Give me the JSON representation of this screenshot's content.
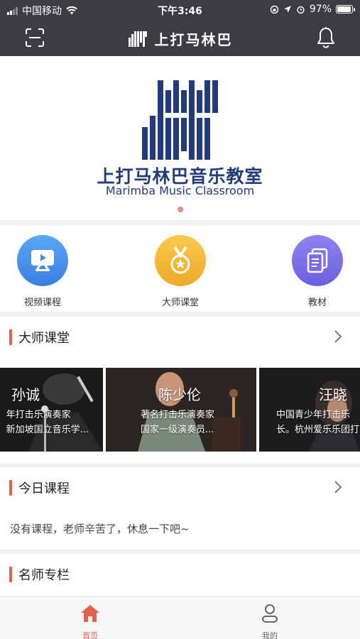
{
  "status_bar": {
    "carrier": "中国移动",
    "time": "下午3:46",
    "battery": "97%",
    "battery_level": 0.97
  },
  "header": {
    "title": "上打马林巴",
    "scan_icon": "scan-icon",
    "bell_icon": "bell-icon"
  },
  "banner": {
    "title_cn": "上打马林巴音乐教室",
    "title_en": "Marimba Music Classroom",
    "dot_color": "#e08a8a"
  },
  "categories": [
    {
      "label": "视频课程",
      "icon": "video-lesson-icon",
      "color": "#4a8ee8"
    },
    {
      "label": "大师课堂",
      "icon": "medal-icon",
      "color": "#f2b83a"
    },
    {
      "label": "教材",
      "icon": "document-icon",
      "color": "#7a6fe6"
    }
  ],
  "master_class": {
    "title": "大师课堂",
    "accent": "#e0624f",
    "teachers": [
      {
        "name": "孙诚",
        "line1": "年打击乐演奏家",
        "line2": "新加坡国立音乐学..."
      },
      {
        "name": "陈少伦",
        "line1": "著名打击乐演奏家",
        "line2": "国家一级演奏员..."
      },
      {
        "name": "汪晓",
        "line1": "中国青少年打击乐",
        "line2": "长。杭州爱乐乐团打"
      }
    ]
  },
  "today": {
    "title": "今日课程",
    "empty_text": "没有课程，老师辛苦了，休息一下吧~"
  },
  "columns": {
    "title": "名师专栏"
  },
  "tabbar": {
    "items": [
      {
        "label": "首页",
        "icon": "home-icon",
        "active": true,
        "color": "#e0624f"
      },
      {
        "label": "我的",
        "icon": "user-icon",
        "active": false,
        "color": "#666666"
      }
    ]
  }
}
